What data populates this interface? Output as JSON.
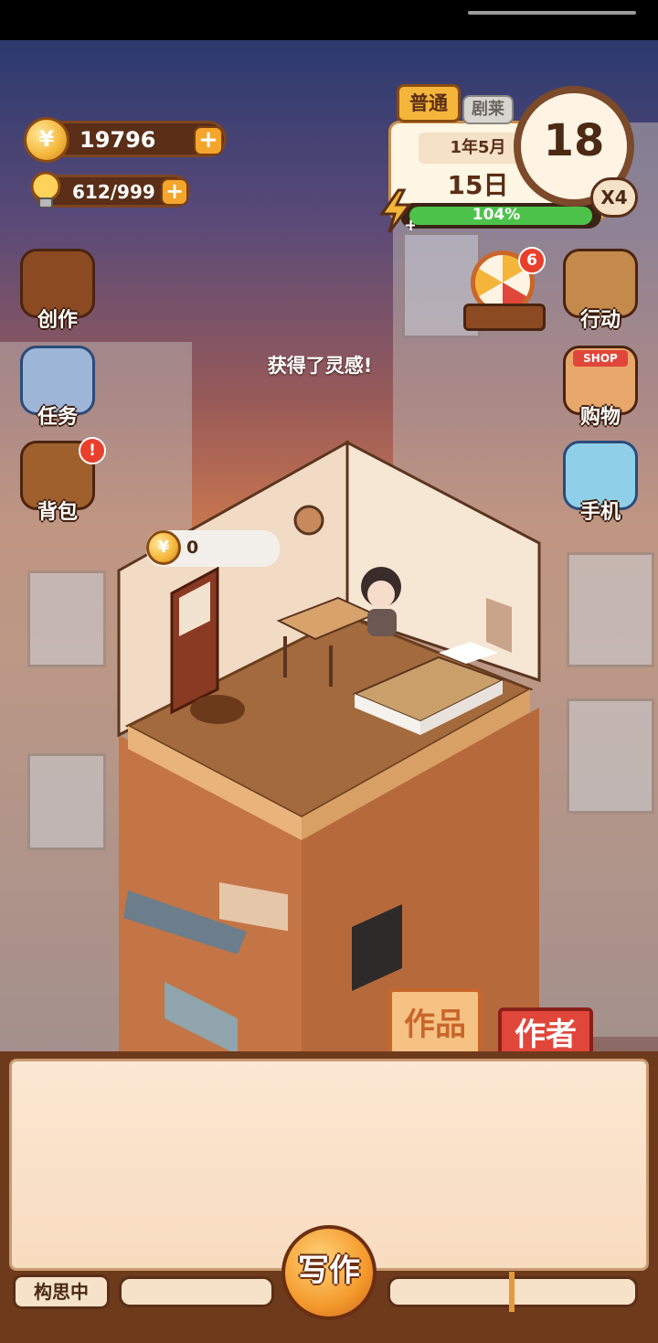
{
  "resources": {
    "coins": "19796",
    "inspiration": "612/999"
  },
  "calendar": {
    "difficulty_tab": "普通",
    "hidden_tab": "剧莱",
    "year_month": "1年5月",
    "day": "15日",
    "hour": "18",
    "speed": "X4",
    "energy_percent": "104%",
    "energy_fill": 1.0
  },
  "left_menu": [
    {
      "label": "创作",
      "icon": "book-icon"
    },
    {
      "label": "任务",
      "icon": "task-clipboard-icon"
    },
    {
      "label": "背包",
      "icon": "backpack-icon"
    }
  ],
  "right_menu": [
    {
      "label": "行动",
      "icon": "door-icon"
    },
    {
      "label": "购物",
      "icon": "shop-icon"
    },
    {
      "label": "手机",
      "icon": "phone-icon"
    }
  ],
  "wheel_badge": "6",
  "shop_sign": "SHOP",
  "notification": "获得了灵感!",
  "coin_bubble_value": "0",
  "tabs": {
    "works": "作品",
    "author": "作者"
  },
  "bottom": {
    "status_label": "构思中",
    "write_button": "写作"
  },
  "colors": {
    "accent_orange": "#f4a52c",
    "energy_green": "#4cc24a",
    "badge_red": "#e8402c",
    "panel_brown": "#6e3a1c"
  }
}
